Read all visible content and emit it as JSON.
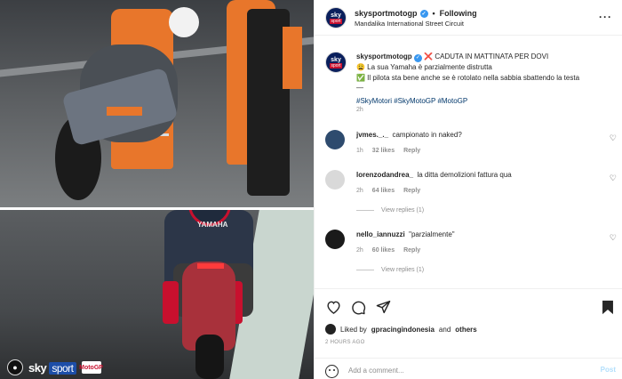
{
  "header": {
    "username": "skysportmotogp",
    "follow_status": "Following",
    "location": "Mandalika International Street Circuit",
    "avatar_line1": "sky",
    "avatar_line2": "sport"
  },
  "caption": {
    "username": "skysportmotogp",
    "line1": "❌ CADUTA IN MATTINATA PER DOVI",
    "line2": "😩 La sua Yamaha è parzialmente distrutta",
    "line3": "✅ Il pilota sta bene anche se è rotolato nella sabbia sbattendo la testa",
    "line4": "—",
    "hashtags": "#SkyMotori #SkyMotoGP #MotoGP",
    "time": "2h"
  },
  "comments": [
    {
      "username": "jvmes._._",
      "text": "campionato in naked?",
      "time": "1h",
      "likes": "32 likes",
      "reply": "Reply",
      "view_replies": ""
    },
    {
      "username": "lorenzodandrea_",
      "text": "la ditta demolizioni fattura qua",
      "time": "2h",
      "likes": "64 likes",
      "reply": "Reply",
      "view_replies": "View replies (1)"
    },
    {
      "username": "nello_iannuzzi",
      "text": "\"parzialmente\"",
      "time": "2h",
      "likes": "60 likes",
      "reply": "Reply",
      "view_replies": "View replies (1)"
    }
  ],
  "likes": {
    "prefix": "Liked by",
    "user": "gpracingindonesia",
    "and": "and",
    "others": "others"
  },
  "post_time": "2 HOURS AGO",
  "add_comment": {
    "placeholder": "Add a comment...",
    "post_label": "Post"
  },
  "media": {
    "sky": "sky",
    "sport": "sport",
    "motogp": "MotoGP"
  },
  "colors": {
    "accent": "#3897f0",
    "hashtag": "#00376b",
    "muted": "#8e8e8e",
    "marshal_orange": "#e8762b"
  }
}
